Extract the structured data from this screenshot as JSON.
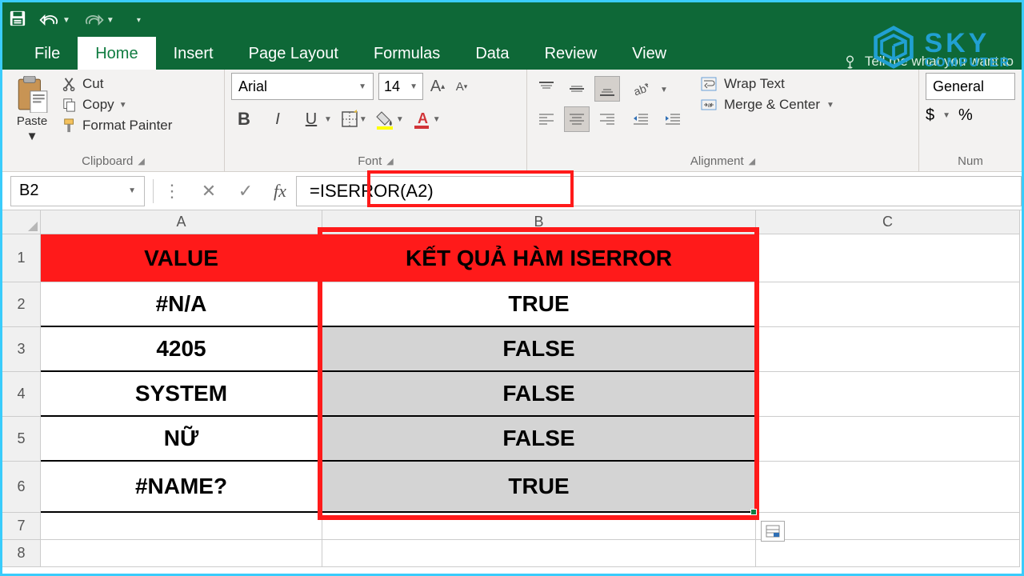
{
  "tabs": {
    "file": "File",
    "home": "Home",
    "insert": "Insert",
    "page_layout": "Page Layout",
    "formulas": "Formulas",
    "data": "Data",
    "review": "Review",
    "view": "View",
    "tell_me": "Tell me what you want to"
  },
  "ribbon": {
    "clipboard": {
      "paste": "Paste",
      "cut": "Cut",
      "copy": "Copy",
      "format_painter": "Format Painter",
      "label": "Clipboard"
    },
    "font": {
      "name": "Arial",
      "size": "14",
      "label": "Font"
    },
    "alignment": {
      "wrap": "Wrap Text",
      "merge": "Merge & Center",
      "label": "Alignment"
    },
    "number": {
      "format": "General",
      "label": "Num"
    }
  },
  "formula_bar": {
    "name_box": "B2",
    "formula": "=ISERROR(A2)"
  },
  "columns": {
    "A": "A",
    "B": "B",
    "C": "C"
  },
  "rows": [
    "1",
    "2",
    "3",
    "4",
    "5",
    "6",
    "7",
    "8"
  ],
  "sheet": {
    "header": {
      "A": "VALUE",
      "B": "KẾT QUẢ HÀM ISERROR"
    },
    "data": [
      {
        "A": "#N/A",
        "B": "TRUE"
      },
      {
        "A": "4205",
        "B": "FALSE"
      },
      {
        "A": "SYSTEM",
        "B": "FALSE"
      },
      {
        "A": "NỮ",
        "B": "FALSE"
      },
      {
        "A": "#NAME?",
        "B": "TRUE"
      }
    ]
  },
  "watermark": {
    "sky": "SKY",
    "computer": "COMPUTER"
  }
}
